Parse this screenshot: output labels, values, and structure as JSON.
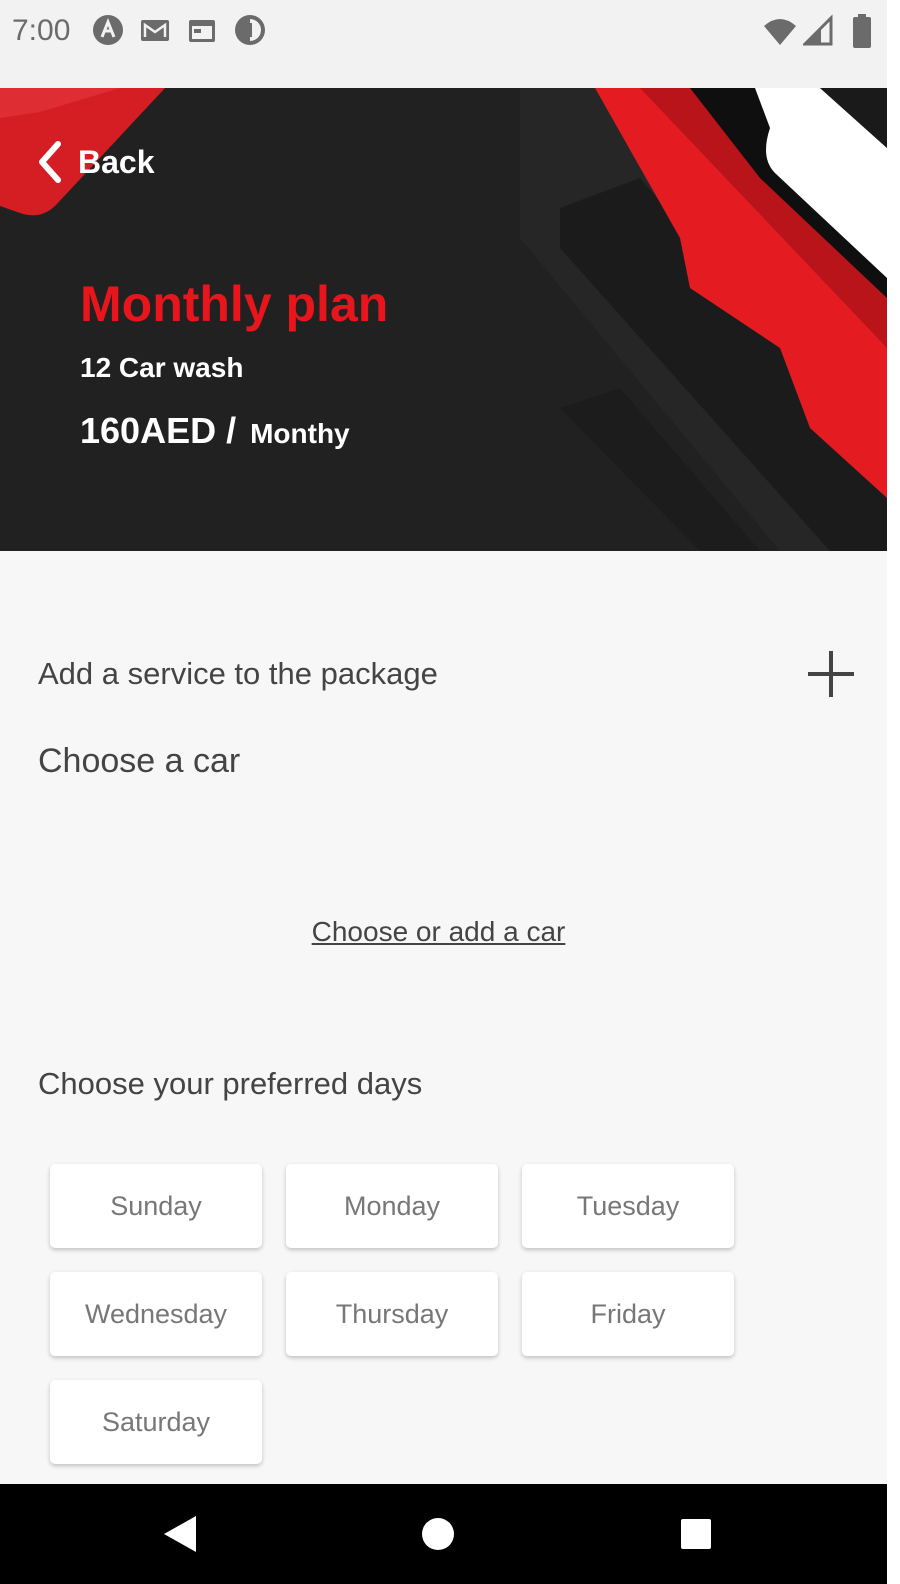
{
  "status_bar": {
    "time": "7:00",
    "left_icons": [
      "notification-a-icon",
      "gmail-icon",
      "calendar-icon",
      "app-icon"
    ],
    "right_icons": [
      "wifi-icon",
      "signal-icon",
      "battery-icon"
    ]
  },
  "header": {
    "back_label": "Back",
    "plan_title": "Monthly plan",
    "washes": "12 Car wash",
    "price": "160AED",
    "slash": "/",
    "period": "Monthy",
    "colors": {
      "accent": "#e8161c",
      "background": "#212121"
    }
  },
  "content": {
    "add_service_label": "Add a service to the package",
    "choose_car_title": "Choose a car",
    "choose_car_link": "Choose or add a car",
    "days_title": "Choose your preferred days",
    "days": [
      {
        "label": "Sunday"
      },
      {
        "label": "Monday"
      },
      {
        "label": "Tuesday"
      },
      {
        "label": "Wednesday"
      },
      {
        "label": "Thursday"
      },
      {
        "label": "Friday"
      },
      {
        "label": "Saturday"
      }
    ]
  },
  "nav_bar": {
    "buttons": [
      "back-triangle-icon",
      "home-circle-icon",
      "recents-square-icon"
    ]
  }
}
